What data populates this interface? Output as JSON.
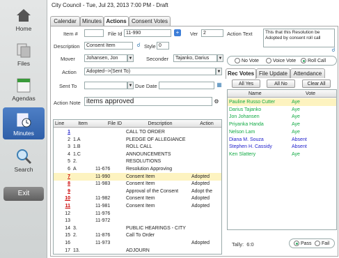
{
  "window": {
    "title": "City Council - Tue, Jul 23, 2013 7:00 PM - Draft"
  },
  "sidebar": {
    "items": [
      {
        "label": "Home",
        "icon": "home-icon"
      },
      {
        "label": "Files",
        "icon": "files-icon"
      },
      {
        "label": "Agendas",
        "icon": "agendas-icon"
      },
      {
        "label": "Minutes",
        "icon": "minutes-icon"
      },
      {
        "label": "Search",
        "icon": "search-icon"
      }
    ],
    "exit_label": "Exit"
  },
  "tabs": [
    "Calendar",
    "Minutes",
    "Actions",
    "Consent Votes"
  ],
  "form": {
    "item_label": "Item #",
    "item_value": "",
    "fileid_label": "File Id",
    "fileid_value": "11-990",
    "ver_label": "Ver",
    "ver_value": "2",
    "desc_label": "Description",
    "desc_value": "Consent Item",
    "style_label": "Style",
    "style_value": "0",
    "mover_label": "Mover",
    "mover_value": "Johansen, Jon",
    "seconder_label": "Seconder",
    "seconder_value": "Tajanko, Darius",
    "action_label": "Action",
    "action_value": "Adopted-->(Sent To)",
    "sentto_label": "Sent To",
    "sentto_value": "",
    "duedate_label": "Due Date",
    "duedate_value": "",
    "note_label": "Action Note",
    "note_value": "items approved"
  },
  "grid": {
    "headers": [
      "Line",
      "Item",
      "File ID",
      "Description",
      "Action"
    ],
    "rows": [
      {
        "line": "1",
        "item": "",
        "file": "",
        "desc": "CALL TO ORDER",
        "action": "",
        "link": true,
        "red": false
      },
      {
        "line": "2",
        "item": "1.A",
        "file": "",
        "desc": "PLEDGE OF ALLEGIANCE",
        "action": "",
        "link": false,
        "red": false
      },
      {
        "line": "3",
        "item": "1.B",
        "file": "",
        "desc": "ROLL CALL",
        "action": "",
        "link": false,
        "red": false
      },
      {
        "line": "4",
        "item": "1.C",
        "file": "",
        "desc": "ANNOUNCEMENTS",
        "action": "",
        "link": false,
        "red": false
      },
      {
        "line": "5",
        "item": "2.",
        "file": "",
        "desc": "RESOLUTIONS",
        "action": "",
        "link": false,
        "red": false
      },
      {
        "line": "6",
        "item": "A",
        "file": "11-676",
        "desc": "Resolution Approving",
        "action": "",
        "link": false,
        "red": false
      },
      {
        "line": "7",
        "item": "",
        "file": "11-990",
        "desc": "Consent Item",
        "action": "Adopted",
        "link": true,
        "red": true
      },
      {
        "line": "8",
        "item": "",
        "file": "11-983",
        "desc": "Consent Item",
        "action": "Adopted",
        "link": true,
        "red": true
      },
      {
        "line": "9",
        "item": "",
        "file": "",
        "desc": "Approval of the Consent",
        "action": "Adopt the",
        "link": true,
        "red": true
      },
      {
        "line": "10",
        "item": "",
        "file": "11-982",
        "desc": "Consent Item",
        "action": "Adopted",
        "link": true,
        "red": true
      },
      {
        "line": "11",
        "item": "",
        "file": "11-981",
        "desc": "Consent Item",
        "action": "Adopted",
        "link": true,
        "red": true
      },
      {
        "line": "12",
        "item": "",
        "file": "11-976",
        "desc": "",
        "action": "",
        "link": false,
        "red": false
      },
      {
        "line": "13",
        "item": "",
        "file": "11-972",
        "desc": "",
        "action": "",
        "link": false,
        "red": false
      },
      {
        "line": "14",
        "item": "3.",
        "file": "",
        "desc": "PUBLIC  HEARINGS - CITY",
        "action": "",
        "link": false,
        "red": false
      },
      {
        "line": "15",
        "item": "2.",
        "file": "11-876",
        "desc": "Call To Order",
        "action": "",
        "link": false,
        "red": false
      },
      {
        "line": "16",
        "item": "",
        "file": "11-973",
        "desc": "",
        "action": "Adopted",
        "link": false,
        "red": false
      },
      {
        "line": "17",
        "item": "13.",
        "file": "",
        "desc": "ADJOURN",
        "action": "",
        "link": false,
        "red": false
      }
    ]
  },
  "right": {
    "action_text_label": "Action Text",
    "action_text_value": "This that this Resolution be Adopted  by consent roll call",
    "vote_options": [
      "No Vote",
      "Voice Vote",
      "Roll Call"
    ],
    "subtabs": [
      "Rec Votes",
      "File Update",
      "Attendance"
    ],
    "buttons": [
      "All Yes",
      "All No",
      "Clear All"
    ],
    "vote_headers": [
      "Name",
      "Vote"
    ],
    "votes": [
      {
        "name": "Pauline Russo Cutter",
        "vote": "Aye"
      },
      {
        "name": "Darius Tajanko",
        "vote": "Aye"
      },
      {
        "name": "Jon Johansen",
        "vote": "Aye"
      },
      {
        "name": "Priyanka Handa",
        "vote": "Aye"
      },
      {
        "name": "Nelson Lam",
        "vote": "Aye"
      },
      {
        "name": "Diana M. Souza",
        "vote": "Absent"
      },
      {
        "name": "Stephen H. Cassidy",
        "vote": "Absent"
      },
      {
        "name": "Ken Slattery",
        "vote": "Aye"
      }
    ],
    "tally_label": "Tally:",
    "tally_value": "6:0",
    "result_options": [
      "Pass",
      "Fail"
    ]
  }
}
